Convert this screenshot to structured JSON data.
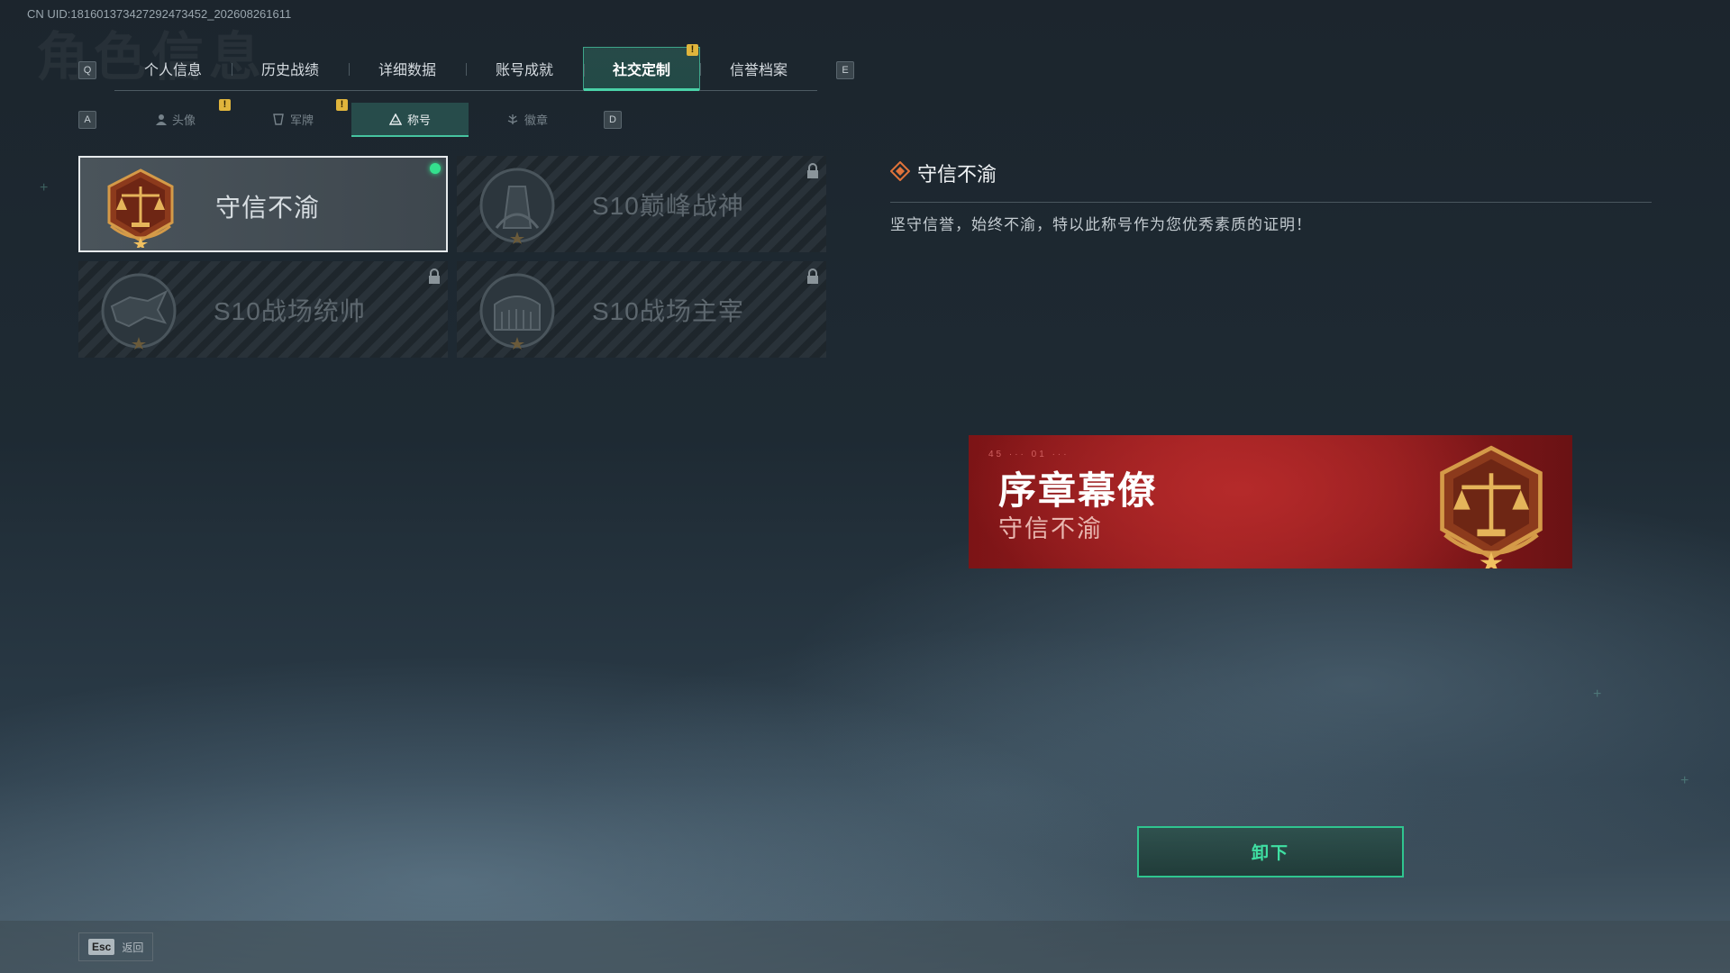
{
  "uid": "CN UID:181601373427292473452_202608261611",
  "header_faint_title": "角色信息",
  "keys": {
    "left": "Q",
    "right": "E",
    "sub_left": "A",
    "sub_right": "D"
  },
  "tabs": [
    {
      "label": "个人信息"
    },
    {
      "label": "历史战绩"
    },
    {
      "label": "详细数据"
    },
    {
      "label": "账号成就"
    },
    {
      "label": "社交定制"
    },
    {
      "label": "信誉档案"
    }
  ],
  "subtabs": [
    {
      "label": "头像",
      "icon": "person-icon"
    },
    {
      "label": "军牌",
      "icon": "dogtag-icon"
    },
    {
      "label": "称号",
      "icon": "triangle-title-icon"
    },
    {
      "label": "徽章",
      "icon": "badge-icon"
    }
  ],
  "titles": [
    {
      "name": "守信不渝",
      "state": "equipped",
      "emblem": "scales-emblem"
    },
    {
      "name": "S10巅峰战神",
      "state": "locked",
      "emblem": "tower-emblem"
    },
    {
      "name": "S10战场统帅",
      "state": "locked",
      "emblem": "dragon-emblem"
    },
    {
      "name": "S10战场主宰",
      "state": "locked",
      "emblem": "colosseum-emblem"
    }
  ],
  "detail": {
    "title": "守信不渝",
    "description": "坚守信誉，始终不渝，特以此称号作为您优秀素质的证明！"
  },
  "banner": {
    "name": "序章幕僚",
    "title": "守信不渝"
  },
  "actions": {
    "unequip": "卸下"
  },
  "footer": {
    "esc_key": "Esc",
    "esc_label": "返回"
  },
  "colors": {
    "accent": "#3fe0a3",
    "banner_red": "#9c1f21",
    "warn": "#e0b53c"
  }
}
